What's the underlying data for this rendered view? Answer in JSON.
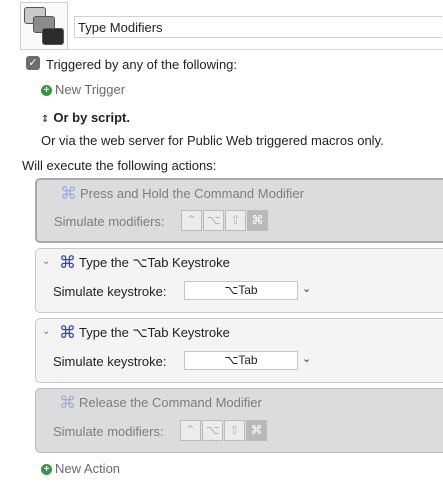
{
  "macro": {
    "name": "Type Modifiers"
  },
  "triggers": {
    "checkbox_label": "Triggered by any of the following:",
    "checkbox_checked": true,
    "new_trigger": "New Trigger",
    "or_by_script": "Or by script.",
    "web_server_note": "Or via the web server for Public Web triggered macros only."
  },
  "actions_heading": "Will execute the following actions:",
  "actions": [
    {
      "title": "Press and Hold the Command Modifier",
      "label": "Simulate modifiers:",
      "enabled": false,
      "modifiers": [
        "⌃",
        "⌥",
        "⇧",
        "⌘"
      ],
      "active_modifier": "⌘"
    },
    {
      "title": "Type the ⌥Tab Keystroke",
      "label": "Simulate keystroke:",
      "keystroke": "⌥Tab"
    },
    {
      "title": "Type the ⌥Tab Keystroke",
      "label": "Simulate keystroke:",
      "keystroke": "⌥Tab"
    },
    {
      "title": "Release the Command Modifier",
      "label": "Simulate modifiers:",
      "enabled": false,
      "modifiers": [
        "⌃",
        "⌥",
        "⇧",
        "⌘"
      ],
      "active_modifier": "⌘"
    }
  ],
  "new_action": "New Action",
  "icons": {
    "command": "⌘",
    "chevron_down": "⌄",
    "plus": "+",
    "stepper": "⌃⌄"
  },
  "colors": {
    "accent": "#2d43d6",
    "add": "#2e9b3e"
  }
}
